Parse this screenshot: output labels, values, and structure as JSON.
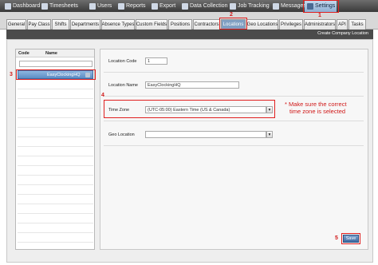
{
  "topnav": {
    "items": [
      {
        "label": "Dashboard",
        "icon": "dashboard-icon"
      },
      {
        "label": "Timesheets",
        "icon": "timesheets-icon"
      },
      {
        "label": "Users",
        "icon": "users-icon"
      },
      {
        "label": "Reports",
        "icon": "reports-icon"
      },
      {
        "label": "Export",
        "icon": "export-icon"
      },
      {
        "label": "Data Collection",
        "icon": "data-collection-icon"
      },
      {
        "label": "Job Tracking",
        "icon": "job-tracking-icon"
      },
      {
        "label": "Messages",
        "icon": "messages-icon"
      },
      {
        "label": "Settings",
        "icon": "settings-icon"
      }
    ],
    "active": "Settings"
  },
  "tabs": {
    "items": [
      "General",
      "Pay Class",
      "Shifts",
      "Departments",
      "Absence Types",
      "Custom Fields",
      "Positions",
      "Contractors",
      "Locations",
      "Geo Locations",
      "Privileges",
      "Administrators",
      "API",
      "Tasks"
    ],
    "active": "Locations"
  },
  "header": {
    "action_label": "Create Company Location"
  },
  "list": {
    "col_code": "Code",
    "col_name": "Name",
    "rows": [
      {
        "code": "",
        "name": "EasyClockingHQ",
        "selected": true
      }
    ]
  },
  "form": {
    "location_code_label": "Location Code",
    "location_code_value": "1",
    "location_name_label": "Location Name",
    "location_name_value": "EasyClockingHQ",
    "time_zone_label": "Time Zone",
    "time_zone_value": "(UTC-05:00) Eastern Time (US & Canada)",
    "geo_location_label": "Geo Location",
    "geo_location_value": ""
  },
  "save_label": "Save",
  "annotations": {
    "steps": [
      "1",
      "2",
      "3",
      "4",
      "5"
    ],
    "note_line1": "* Make sure the correct",
    "note_line2": "time zone is selected",
    "color": "#e02020"
  },
  "colors": {
    "accent": "#7f9fc3",
    "nav_bg": "#4a4a4a"
  }
}
